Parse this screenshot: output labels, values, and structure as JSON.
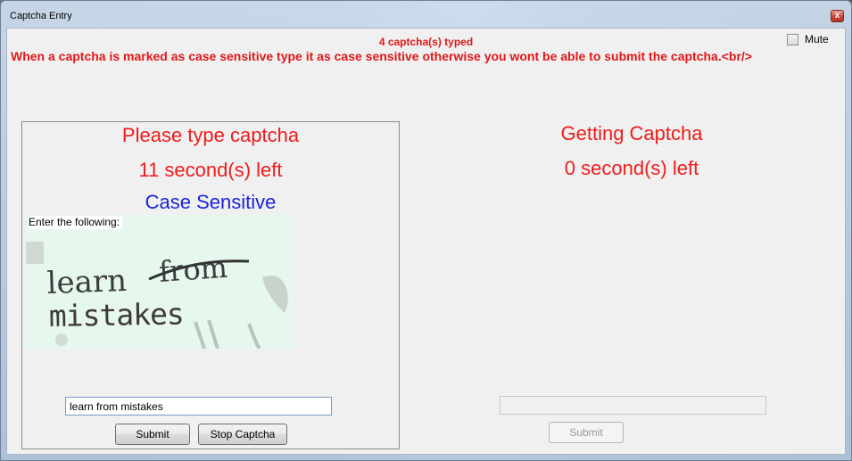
{
  "window": {
    "title": "Captcha Entry",
    "close_glyph": "x"
  },
  "header": {
    "typed_count": "4 captcha(s) typed",
    "warning": "When a captcha is marked as case sensitive type it as case sensitive otherwise you wont be able to submit the captcha.<br/>",
    "mute_label": "Mute",
    "mute_checked": false
  },
  "left_panel": {
    "status": "Please type captcha",
    "timer": "11 second(s) left",
    "case_note": "Case Sensitive",
    "captcha_label": "Enter the following:",
    "captcha_words": [
      "learn",
      "from",
      "mistakes"
    ],
    "input_value": "learn from mistakes",
    "submit_label": "Submit",
    "stop_label": "Stop Captcha"
  },
  "right_panel": {
    "status": "Getting Captcha",
    "timer": "0 second(s) left",
    "input_value": "",
    "submit_label": "Submit"
  },
  "colors": {
    "alert_red": "#ee1c1c",
    "case_blue": "#1b24d6"
  }
}
